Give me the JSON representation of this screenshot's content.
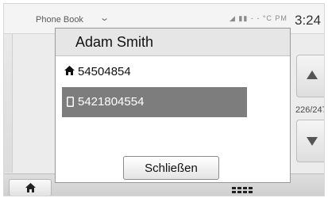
{
  "header": {
    "title": "Phone Book",
    "chevron_icon": "chevron-down-icon",
    "status_text": "◢ ▮▮  - - °C  PM",
    "clock": "3:24"
  },
  "right_panel": {
    "counter": "226/247",
    "up_icon": "arrow-up-icon",
    "down_icon": "arrow-down-icon"
  },
  "bottom_bar": {
    "home_icon": "home-icon",
    "keypad_icon": "keypad-icon"
  },
  "popup": {
    "title": "Adam Smith",
    "numbers": [
      {
        "type": "home",
        "icon": "home-icon",
        "value": "54504854"
      },
      {
        "type": "mobile",
        "icon": "mobile-phone-icon",
        "value": "5421804554"
      }
    ],
    "close_label": "Schließen"
  },
  "colors": {
    "selected_row": "#7d7d7d",
    "header_bg": "#e6e6e6",
    "text": "#111111"
  }
}
